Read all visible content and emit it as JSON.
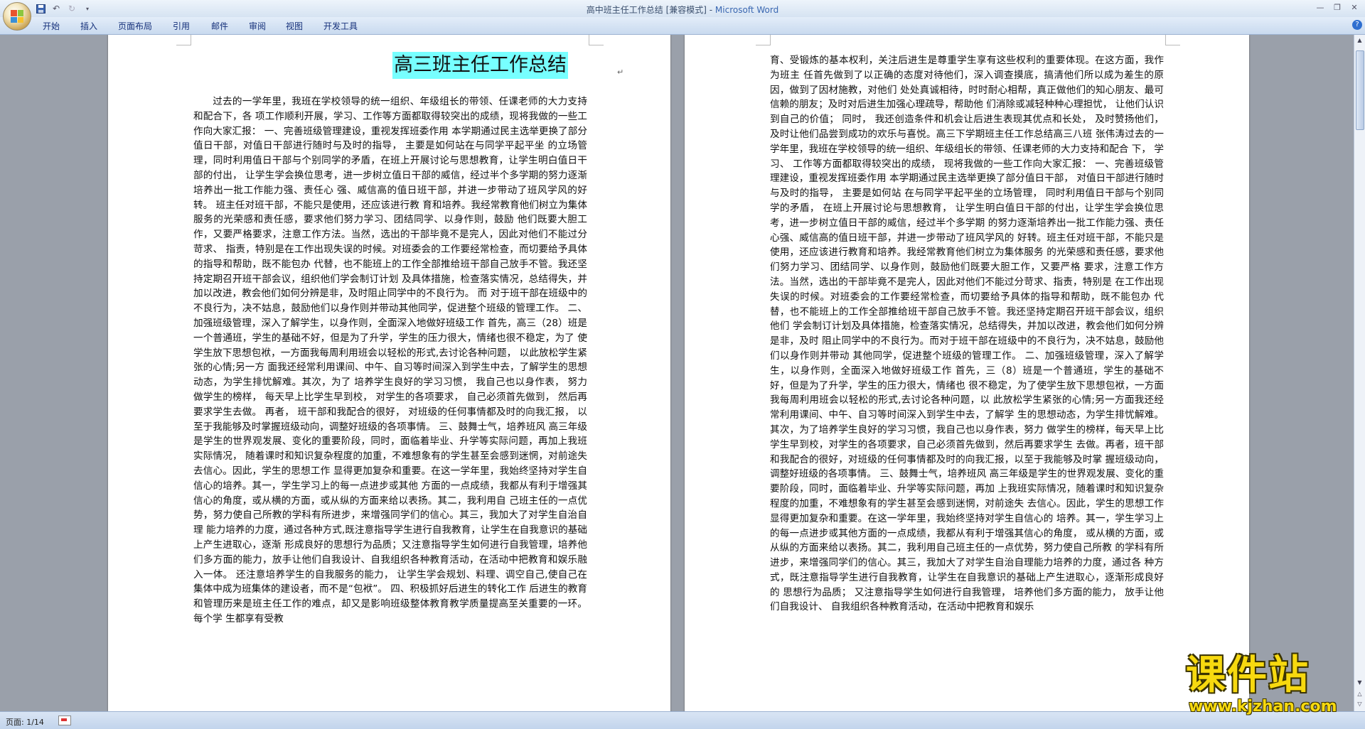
{
  "window": {
    "title": "高中班主任工作总结 [兼容模式] - ",
    "app_name": "Microsoft Word",
    "controls": [
      "minimize",
      "restore",
      "close"
    ]
  },
  "quick_access": {
    "save_icon": "save-icon",
    "undo_icon": "undo-icon",
    "redo_icon": "redo-icon",
    "customize_icon": "dropdown-icon"
  },
  "ribbon": {
    "tabs": [
      "开始",
      "插入",
      "页面布局",
      "引用",
      "邮件",
      "审阅",
      "视图",
      "开发工具"
    ],
    "help": "?"
  },
  "document": {
    "page1": {
      "title": "高三班主任工作总结",
      "paragraph_mark": "↵",
      "body": "过去的一学年里，我班在学校领导的统一组织、年级组长的带领、任课老师的大力支持和配合下，各 项工作顺利开展，学习、工作等方面都取得较突出的成绩，现将我做的一些工作向大家汇报： 一、完善班级管理建设，重视发挥班委作用 本学期通过民主选举更换了部分值日干部，对值日干部进行随时与及时的指导， 主要是如何站在与同学平起平坐 的立场管理，同时利用值日干部与个别同学的矛盾，在班上开展讨论与思想教育，让学生明白值日干部的付出， 让学生学会换位思考，进一步树立值日干部的威信，经过半个多学期的努力逐渐培养出一批工作能力强、责任心 强、威信高的值日班干部，并进一步带动了班风学风的好转。 班主任对班干部，不能只是使用，还应该进行教 育和培养。我经常教育他们树立为集体服务的光荣感和责任感，要求他们努力学习、团结同学、以身作则，鼓励 他们既要大胆工作，又要严格要求，注意工作方法。当然，选出的干部毕竟不是完人，因此对他们不能过分苛求、 指责，特别是在工作出现失误的时候。对班委会的工作要经常检查，而切要给予具体的指导和帮助，既不能包办 代替，也不能班上的工作全部推给班干部自己放手不管。我还坚持定期召开班干部会议，组织他们学会制订计划 及具体措施，检查落实情况，总结得失，并加以改进，教会他们如何分辨是非，及时阻止同学中的不良行为。 而 对于班干部在班级中的不良行为，决不姑息，鼓励他们以身作则并带动其他同学，促进整个班级的管理工作。 二、加强班级管理，深入了解学生，以身作则，全面深入地做好班级工作 首先，高三（28）班是一个普通班，学生的基础不好，但是为了升学，学生的压力很大，情绪也很不稳定，为了 使学生放下思想包袱，一方面我每周利用班会以轻松的形式,去讨论各种问题， 以此放松学生紧张的心情;另一方 面我还经常利用课间、中午、自习等时间深入到学生中去，了解学生的思想动态，为学生排忧解难。其次，为了 培养学生良好的学习习惯， 我自己也以身作表， 努力做学生的榜样， 每天早上比学生早到校， 对学生的各项要求， 自己必须首先做到， 然后再要求学生去做。 再者， 班干部和我配合的很好， 对班级的任何事情都及时的向我汇报， 以至于我能够及时掌握班级动向，调整好班级的各项事情。 三、鼓舞士气，培养班风 高三年级是学生的世界观发展、变化的重要阶段，同时，面临着毕业、升学等实际问题，再加上我班实际情况， 随着课时和知识复杂程度的加重，不难想象有的学生甚至会感到迷惘，对前途失去信心。因此，学生的思想工作 显得更加复杂和重要。在这一学年里，我始终坚持对学生自信心的培养。其一，学生学习上的每一点进步或其他 方面的一点成绩，我都从有利于增强其信心的角度，或从横的方面，或从纵的方面来给以表扬。其二，我利用自 己班主任的一点优势，努力使自己所教的学科有所进步，来增强同学们的信心。其三，我加大了对学生自治自理 能力培养的力度，通过各种方式,既注意指导学生进行自我教育，让学生在自我意识的基础上产生进取心，逐渐 形成良好的思想行为品质；又注意指导学生如何进行自我管理，培养他们多方面的能力，放手让他们自我设计、自我组织各种教育活动，在活动中把教育和娱乐融入一体。 还注意培养学生的自我服务的能力， 让学生学会规划、料理、调空自己,使自己在集体中成为班集体的建设者，而不是“包袱”。 四、积极抓好后进生的转化工作 后进生的教育和管理历来是班主任工作的难点，却又是影响班级整体教育教学质量提高至关重要的一环。每个学 生都享有受教"
    },
    "page2": {
      "body": "育、受锻炼的基本权利，关注后进生是尊重学生享有这些权利的重要体现。在这方面，我作为班主 任首先做到了以正确的态度对待他们，深入调查摸底，搞清他们所以成为差生的原因，做到了因材施教，对他们 处处真诚相待，时时耐心相帮，真正做他们的知心朋友、最可信赖的朋友；及时对后进生加强心理疏导，帮助他 们消除或减轻种种心理担忧， 让他们认识到自己的价值； 同时， 我还创造条件和机会让后进生表现其优点和长处， 及时赞扬他们，及时让他们品尝到成功的欢乐与喜悦。高三下学期班主任工作总结高三八班 张伟涛过去的一学年里，我班在学校领导的统一组织、年级组长的带领、任课老师的大力支持和配合 下， 学习、 工作等方面都取得较突出的成绩， 现将我做的一些工作向大家汇报： 一、完善班级管理建设，重视发挥班委作用 本学期通过民主选举更换了部分值日干部， 对值日干部进行随时与及时的指导， 主要是如何站 在与同学平起平坐的立场管理， 同时利用值日干部与个别同学的矛盾， 在班上开展讨论与思想教育， 让学生明白值日干部的付出，让学生学会换位思考，进一步树立值日干部的威信，经过半个多学期 的努力逐渐培养出一批工作能力强、责任心强、威信高的值日班干部，并进一步带动了班风学风的 好转。班主任对班干部，不能只是使用，还应该进行教育和培养。我经常教育他们树立为集体服务 的光荣感和责任感，要求他们努力学习、团结同学、以身作则，鼓励他们既要大胆工作，又要严格 要求，注意工作方法。当然，选出的干部毕竟不是完人，因此对他们不能过分苛求、指责，特别是 在工作出现失误的时候。对班委会的工作要经常检查，而切要给予具体的指导和帮助，既不能包办 代替，也不能班上的工作全部推给班干部自己放手不管。我还坚持定期召开班干部会议，组织他们 学会制订计划及具体措施，检查落实情况，总结得失，并加以改进，教会他们如何分辨是非，及时 阻止同学中的不良行为。而对于班干部在班级中的不良行为，决不姑息，鼓励他们以身作则并带动 其他同学，促进整个班级的管理工作。 二、加强班级管理，深入了解学生，以身作则，全面深入地做好班级工作 首先，三（8）班是一个普通班，学生的基础不好，但是为了升学，学生的压力很大，情绪也 很不稳定，为了使学生放下思想包袱，一方面我每周利用班会以轻松的形式,去讨论各种问题，以 此放松学生紧张的心情;另一方面我还经常利用课间、中午、自习等时间深入到学生中去，了解学 生的思想动态，为学生排忧解难。其次，为了培养学生良好的学习习惯，我自己也以身作表，努力 做学生的榜样，每天早上比学生早到校，对学生的各项要求，自己必须首先做到，然后再要求学生 去做。再者，班干部和我配合的很好，对班级的任何事情都及时的向我汇报，以至于我能够及时掌 握班级动向，调整好班级的各项事情。 三、鼓舞士气，培养班风 高三年级是学生的世界观发展、变化的重要阶段，同时，面临着毕业、升学等实际问题，再加 上我班实际情况，随着课时和知识复杂程度的加重，不难想象有的学生甚至会感到迷惘，对前途失 去信心。因此，学生的思想工作显得更加复杂和重要。在这一学年里，我始终坚持对学生自信心的 培养。其一，学生学习上的每一点进步或其他方面的一点成绩，我都从有利于增强其信心的角度， 或从横的方面，或从纵的方面来给以表扬。其二，我利用自己班主任的一点优势，努力使自己所教 的学科有所进步，来增强同学们的信心。其三，我加大了对学生自治自理能力培养的力度，通过各 种方式，既注意指导学生进行自我教育，让学生在自我意识的基础上产生进取心，逐渐形成良好 的 思想行为品质； 又注意指导学生如何进行自我管理， 培养他们多方面的能力， 放手让他们自我设计、 自我组织各种教育活动，在活动中把教育和娱乐"
    }
  },
  "statusbar": {
    "page_info": "页面: 1/14"
  },
  "watermark": {
    "main": "课件站",
    "url": "www.kjzhan.com"
  }
}
